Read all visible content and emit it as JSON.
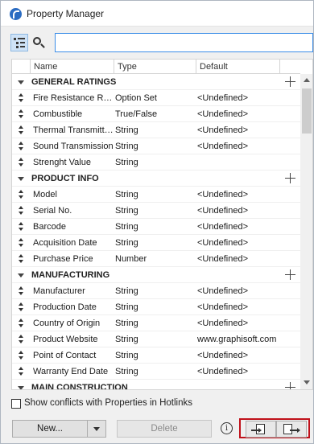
{
  "window": {
    "title": "Property Manager"
  },
  "toolbar": {
    "search_value": ""
  },
  "grid": {
    "columns": {
      "name": "Name",
      "type": "Type",
      "default": "Default"
    },
    "groups": [
      {
        "label": "GENERAL RATINGS",
        "rows": [
          {
            "name": "Fire Resistance Rating",
            "type": "Option Set",
            "default": "<Undefined>"
          },
          {
            "name": "Combustible",
            "type": "True/False",
            "default": "<Undefined>"
          },
          {
            "name": "Thermal Transmittance",
            "type": "String",
            "default": "<Undefined>"
          },
          {
            "name": "Sound Transmission",
            "type": "String",
            "default": "<Undefined>"
          },
          {
            "name": "Strenght Value",
            "type": "String",
            "default": ""
          }
        ]
      },
      {
        "label": "PRODUCT INFO",
        "rows": [
          {
            "name": "Model",
            "type": "String",
            "default": "<Undefined>"
          },
          {
            "name": "Serial No.",
            "type": "String",
            "default": "<Undefined>"
          },
          {
            "name": "Barcode",
            "type": "String",
            "default": "<Undefined>"
          },
          {
            "name": "Acquisition Date",
            "type": "String",
            "default": "<Undefined>"
          },
          {
            "name": "Purchase Price",
            "type": "Number",
            "default": "<Undefined>"
          }
        ]
      },
      {
        "label": "MANUFACTURING",
        "rows": [
          {
            "name": "Manufacturer",
            "type": "String",
            "default": "<Undefined>"
          },
          {
            "name": "Production Date",
            "type": "String",
            "default": "<Undefined>"
          },
          {
            "name": "Country of Origin",
            "type": "String",
            "default": "<Undefined>"
          },
          {
            "name": "Product Website",
            "type": "String",
            "default": "www.graphisoft.com"
          },
          {
            "name": "Point of Contact",
            "type": "String",
            "default": "<Undefined>"
          },
          {
            "name": "Warranty End Date",
            "type": "String",
            "default": "<Undefined>"
          }
        ]
      },
      {
        "label": "MAIN CONSTRUCTION",
        "rows": []
      }
    ]
  },
  "options": {
    "show_conflicts_label": "Show conflicts with Properties in Hotlinks",
    "show_conflicts_checked": false
  },
  "footer": {
    "new_label": "New...",
    "delete_label": "Delete",
    "info_label": "i"
  },
  "icons": [
    "app-logo-icon",
    "tree-view-icon",
    "search-icon",
    "chevron-down-icon",
    "drag-handle-icon",
    "add-icon",
    "info-icon",
    "import-icon",
    "export-icon"
  ],
  "colors": {
    "highlight_border": "#c0111a",
    "search_focus": "#3c8ee8",
    "tree_toggle_bg": "#cfe3f7"
  }
}
